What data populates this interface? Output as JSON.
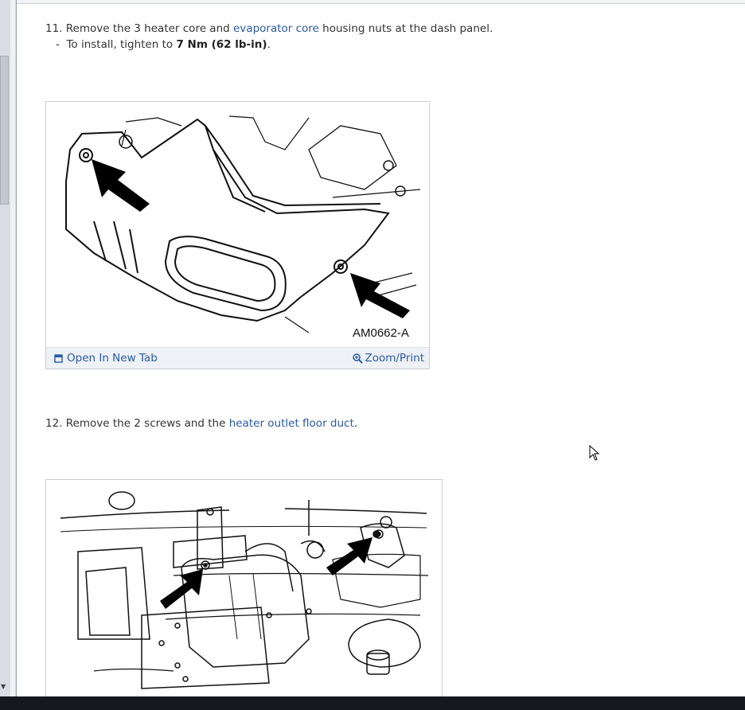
{
  "steps": [
    {
      "number": "11.",
      "text_before": "Remove the 3 heater core and",
      "link": "evaporator core",
      "text_after": "housing nuts at the dash panel.",
      "sub_prefix": "-",
      "sub_text": "To install, tighten to",
      "sub_bold": "7 Nm (62 lb-in)",
      "sub_end": ".",
      "figure_label": "AM0662-A"
    },
    {
      "number": "12.",
      "text_before": "Remove the 2 screws and the",
      "link": "heater outlet floor duct",
      "text_after": "."
    }
  ],
  "figure_actions": {
    "open_new_tab": "Open In New Tab",
    "zoom_print": "Zoom/Print"
  },
  "icons": [
    "open-in-new-tab-icon",
    "zoom-icon",
    "mouse-cursor-icon"
  ],
  "colors": {
    "link": "#2a5aa5",
    "footer_bg": "#eef1f5",
    "taskbar": "#15191d"
  }
}
